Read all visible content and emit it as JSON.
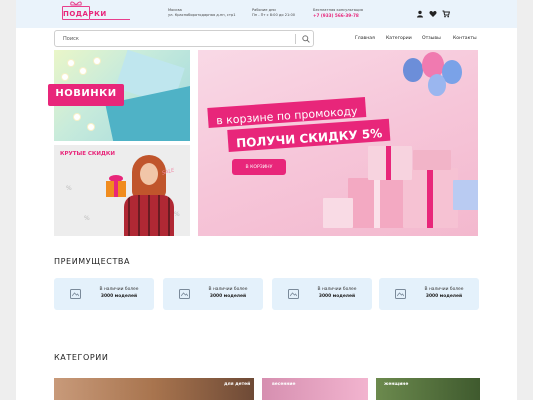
{
  "header": {
    "logo_text": "ПОДАРКИ",
    "address_line1": "Москва",
    "address_line2": "ул. Красноборотодарная д.нн, стр1",
    "hours_line1": "Рабочие дни",
    "hours_line2": "Пн - Пт с 8:00 до 21:00",
    "phone_caption": "Бесплатная консультация",
    "phone": "+7 (933) 566-39-78",
    "icons": [
      "user-icon",
      "heart-icon",
      "cart-icon"
    ]
  },
  "search": {
    "placeholder": "Поиск"
  },
  "nav": {
    "items": [
      "Главная",
      "Категории",
      "Отзывы",
      "Контакты"
    ]
  },
  "promo_new": {
    "label": "НОВИНКИ"
  },
  "promo_sale": {
    "title": "КРУТЫЕ СКИДКИ",
    "tag": "SALE",
    "symbol": "%"
  },
  "banner": {
    "line1": "в корзине по промокоду",
    "line2": "ПОЛУЧИ СКИДКУ 5%",
    "button": "В КОРЗИНУ"
  },
  "advantages": {
    "title": "ПРЕИМУЩЕСТВА",
    "cards": [
      {
        "line1": "В наличии более",
        "line2": "3000 моделей"
      },
      {
        "line1": "В наличии более",
        "line2": "3000 моделей"
      },
      {
        "line1": "В наличии более",
        "line2": "3000 моделей"
      },
      {
        "line1": "В наличии более",
        "line2": "3000 моделей"
      }
    ]
  },
  "categories": {
    "title": "КАТЕГОРИИ",
    "items": [
      "для детей",
      "весенние",
      "женщине"
    ]
  },
  "colors": {
    "accent": "#e8267a",
    "header_bg": "#eaf3fb",
    "card_bg": "#e4f1fb"
  }
}
